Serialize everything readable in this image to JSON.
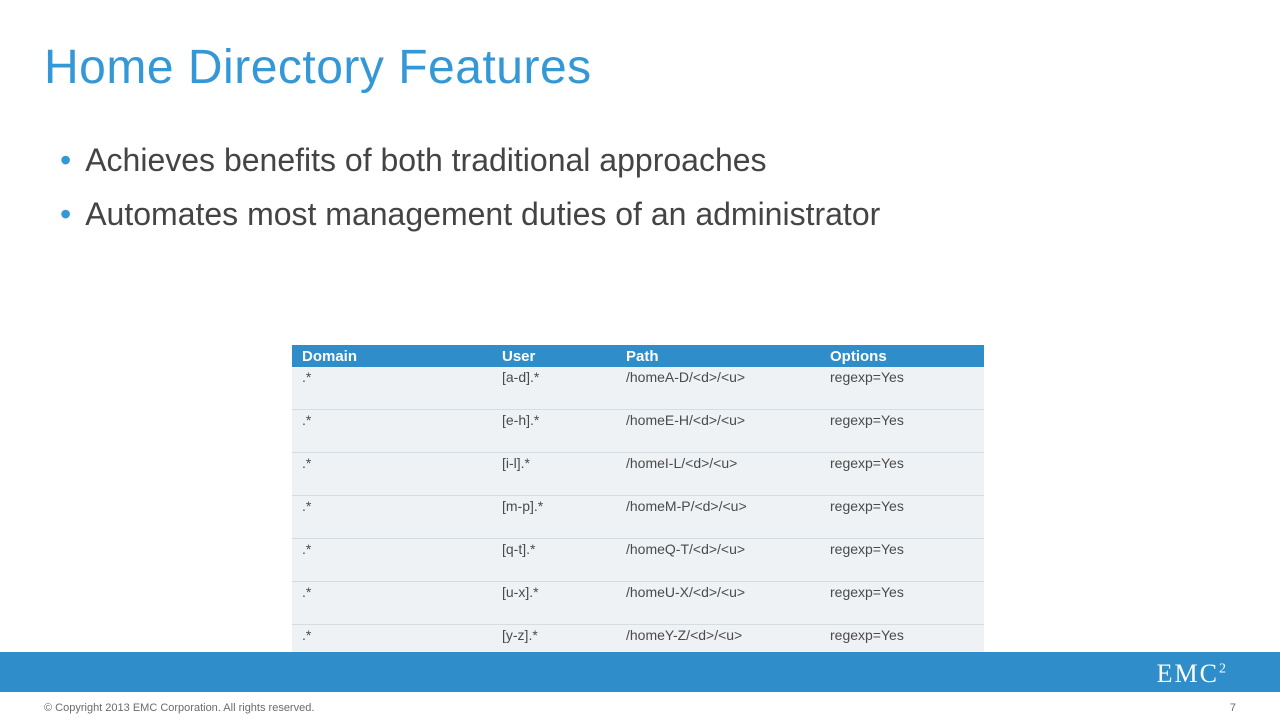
{
  "title": "Home Directory Features",
  "bullets": [
    "Achieves benefits of both traditional approaches",
    "Automates most management duties of an administrator"
  ],
  "table": {
    "headers": {
      "domain": "Domain",
      "user": "User",
      "path": "Path",
      "options": "Options"
    },
    "rows": [
      {
        "domain": ".*",
        "user": "[a-d].*",
        "path": "/homeA-D/<d>/<u>",
        "options": "regexp=Yes"
      },
      {
        "domain": ".*",
        "user": "[e-h].*",
        "path": "/homeE-H/<d>/<u>",
        "options": "regexp=Yes"
      },
      {
        "domain": ".*",
        "user": "[i-l].*",
        "path": "/homeI-L/<d>/<u>",
        "options": "regexp=Yes"
      },
      {
        "domain": ".*",
        "user": "[m-p].*",
        "path": "/homeM-P/<d>/<u>",
        "options": "regexp=Yes"
      },
      {
        "domain": ".*",
        "user": "[q-t].*",
        "path": "/homeQ-T/<d>/<u>",
        "options": "regexp=Yes"
      },
      {
        "domain": ".*",
        "user": "[u-x].*",
        "path": "/homeU-X/<d>/<u>",
        "options": "regexp=Yes"
      },
      {
        "domain": ".*",
        "user": "[y-z].*",
        "path": "/homeY-Z/<d>/<u>",
        "options": "regexp=Yes"
      }
    ]
  },
  "footer": {
    "logo_main": "EMC",
    "logo_sup": "2",
    "copyright": "© Copyright 2013 EMC Corporation. All rights reserved.",
    "page": "7"
  },
  "colors": {
    "accent": "#2f8dca",
    "title": "#3498d6"
  }
}
